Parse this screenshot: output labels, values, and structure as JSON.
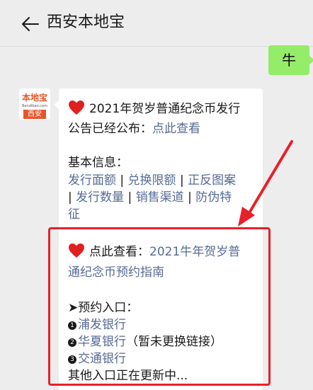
{
  "header": {
    "title": "西安本地宝"
  },
  "me_message": "牛",
  "avatar": {
    "logo_text": "本地宝",
    "logo_url": "Bendibao.com",
    "city": "西安"
  },
  "message": {
    "line1_text": "2021年贺岁普通纪念币发行",
    "line2_text": "公告已经公布：",
    "line2_link": "点此查看",
    "basic_label": "基本信息：",
    "basic_links": [
      "发行面额",
      "兑换限额",
      "正反图案",
      "发行数量",
      "销售渠道",
      "防伪特征"
    ],
    "sep": " | ",
    "view_label": "点此查看：",
    "view_link_1": "2021牛年贺岁普",
    "view_link_2": "通纪念币预约指南",
    "entry_label": "➤预约入口：",
    "entries": [
      {
        "num": "1",
        "link": "浦发银行",
        "note": ""
      },
      {
        "num": "2",
        "link": "华夏银行",
        "note": "（暂未更换链接）"
      },
      {
        "num": "3",
        "link": "交通银行",
        "note": ""
      }
    ],
    "more": "其他入口正在更新中..."
  },
  "colors": {
    "link": "#576b95",
    "highlight": "#e8202a",
    "heart": "#e02020"
  }
}
